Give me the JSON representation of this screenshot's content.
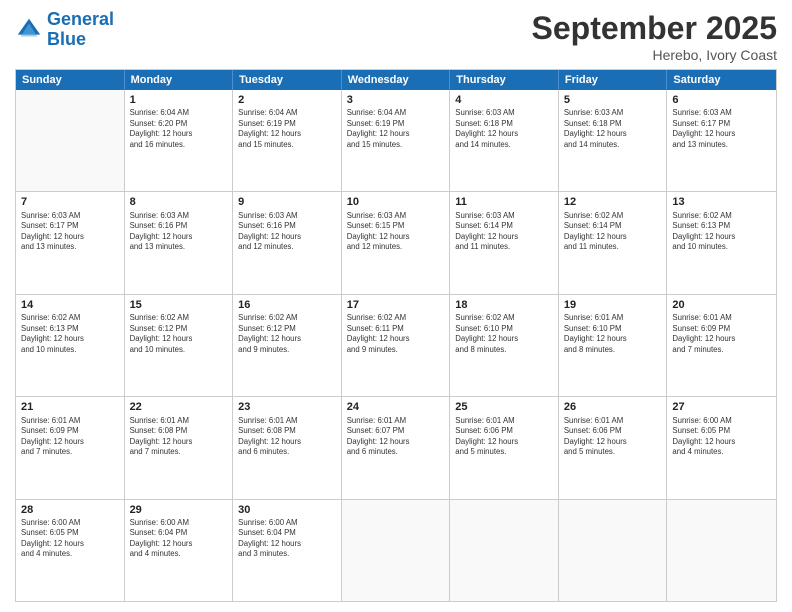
{
  "logo": {
    "line1": "General",
    "line2": "Blue"
  },
  "title": "September 2025",
  "subtitle": "Herebo, Ivory Coast",
  "days": [
    "Sunday",
    "Monday",
    "Tuesday",
    "Wednesday",
    "Thursday",
    "Friday",
    "Saturday"
  ],
  "weeks": [
    [
      {
        "num": "",
        "info": ""
      },
      {
        "num": "1",
        "info": "Sunrise: 6:04 AM\nSunset: 6:20 PM\nDaylight: 12 hours\nand 16 minutes."
      },
      {
        "num": "2",
        "info": "Sunrise: 6:04 AM\nSunset: 6:19 PM\nDaylight: 12 hours\nand 15 minutes."
      },
      {
        "num": "3",
        "info": "Sunrise: 6:04 AM\nSunset: 6:19 PM\nDaylight: 12 hours\nand 15 minutes."
      },
      {
        "num": "4",
        "info": "Sunrise: 6:03 AM\nSunset: 6:18 PM\nDaylight: 12 hours\nand 14 minutes."
      },
      {
        "num": "5",
        "info": "Sunrise: 6:03 AM\nSunset: 6:18 PM\nDaylight: 12 hours\nand 14 minutes."
      },
      {
        "num": "6",
        "info": "Sunrise: 6:03 AM\nSunset: 6:17 PM\nDaylight: 12 hours\nand 13 minutes."
      }
    ],
    [
      {
        "num": "7",
        "info": "Sunrise: 6:03 AM\nSunset: 6:17 PM\nDaylight: 12 hours\nand 13 minutes."
      },
      {
        "num": "8",
        "info": "Sunrise: 6:03 AM\nSunset: 6:16 PM\nDaylight: 12 hours\nand 13 minutes."
      },
      {
        "num": "9",
        "info": "Sunrise: 6:03 AM\nSunset: 6:16 PM\nDaylight: 12 hours\nand 12 minutes."
      },
      {
        "num": "10",
        "info": "Sunrise: 6:03 AM\nSunset: 6:15 PM\nDaylight: 12 hours\nand 12 minutes."
      },
      {
        "num": "11",
        "info": "Sunrise: 6:03 AM\nSunset: 6:14 PM\nDaylight: 12 hours\nand 11 minutes."
      },
      {
        "num": "12",
        "info": "Sunrise: 6:02 AM\nSunset: 6:14 PM\nDaylight: 12 hours\nand 11 minutes."
      },
      {
        "num": "13",
        "info": "Sunrise: 6:02 AM\nSunset: 6:13 PM\nDaylight: 12 hours\nand 10 minutes."
      }
    ],
    [
      {
        "num": "14",
        "info": "Sunrise: 6:02 AM\nSunset: 6:13 PM\nDaylight: 12 hours\nand 10 minutes."
      },
      {
        "num": "15",
        "info": "Sunrise: 6:02 AM\nSunset: 6:12 PM\nDaylight: 12 hours\nand 10 minutes."
      },
      {
        "num": "16",
        "info": "Sunrise: 6:02 AM\nSunset: 6:12 PM\nDaylight: 12 hours\nand 9 minutes."
      },
      {
        "num": "17",
        "info": "Sunrise: 6:02 AM\nSunset: 6:11 PM\nDaylight: 12 hours\nand 9 minutes."
      },
      {
        "num": "18",
        "info": "Sunrise: 6:02 AM\nSunset: 6:10 PM\nDaylight: 12 hours\nand 8 minutes."
      },
      {
        "num": "19",
        "info": "Sunrise: 6:01 AM\nSunset: 6:10 PM\nDaylight: 12 hours\nand 8 minutes."
      },
      {
        "num": "20",
        "info": "Sunrise: 6:01 AM\nSunset: 6:09 PM\nDaylight: 12 hours\nand 7 minutes."
      }
    ],
    [
      {
        "num": "21",
        "info": "Sunrise: 6:01 AM\nSunset: 6:09 PM\nDaylight: 12 hours\nand 7 minutes."
      },
      {
        "num": "22",
        "info": "Sunrise: 6:01 AM\nSunset: 6:08 PM\nDaylight: 12 hours\nand 7 minutes."
      },
      {
        "num": "23",
        "info": "Sunrise: 6:01 AM\nSunset: 6:08 PM\nDaylight: 12 hours\nand 6 minutes."
      },
      {
        "num": "24",
        "info": "Sunrise: 6:01 AM\nSunset: 6:07 PM\nDaylight: 12 hours\nand 6 minutes."
      },
      {
        "num": "25",
        "info": "Sunrise: 6:01 AM\nSunset: 6:06 PM\nDaylight: 12 hours\nand 5 minutes."
      },
      {
        "num": "26",
        "info": "Sunrise: 6:01 AM\nSunset: 6:06 PM\nDaylight: 12 hours\nand 5 minutes."
      },
      {
        "num": "27",
        "info": "Sunrise: 6:00 AM\nSunset: 6:05 PM\nDaylight: 12 hours\nand 4 minutes."
      }
    ],
    [
      {
        "num": "28",
        "info": "Sunrise: 6:00 AM\nSunset: 6:05 PM\nDaylight: 12 hours\nand 4 minutes."
      },
      {
        "num": "29",
        "info": "Sunrise: 6:00 AM\nSunset: 6:04 PM\nDaylight: 12 hours\nand 4 minutes."
      },
      {
        "num": "30",
        "info": "Sunrise: 6:00 AM\nSunset: 6:04 PM\nDaylight: 12 hours\nand 3 minutes."
      },
      {
        "num": "",
        "info": ""
      },
      {
        "num": "",
        "info": ""
      },
      {
        "num": "",
        "info": ""
      },
      {
        "num": "",
        "info": ""
      }
    ]
  ]
}
